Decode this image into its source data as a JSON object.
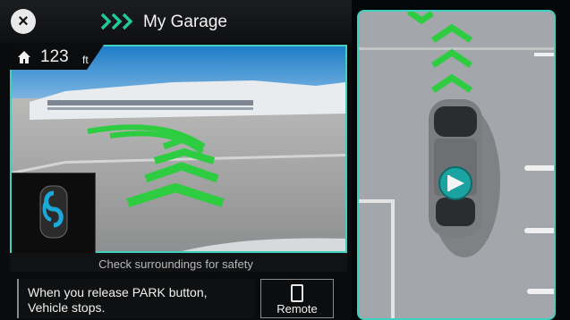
{
  "header": {
    "title": "My Garage"
  },
  "camera_view": {
    "distance_value": "123",
    "distance_unit": "ft"
  },
  "messages": {
    "safety": "Check surroundings for safety"
  },
  "info": {
    "line1": "When you release PARK button,",
    "line2": "Vehicle stops."
  },
  "buttons": {
    "remote_label": "Remote"
  },
  "colors": {
    "accent": "#3fd0c0",
    "guide": "#2ecc40",
    "park_badge": "#1aa3a1"
  },
  "icons": {
    "close": "close-icon",
    "direction": "chevron-right-icon",
    "home": "home-icon",
    "remote": "phone-icon",
    "park_assist": "park-assist-icon"
  }
}
